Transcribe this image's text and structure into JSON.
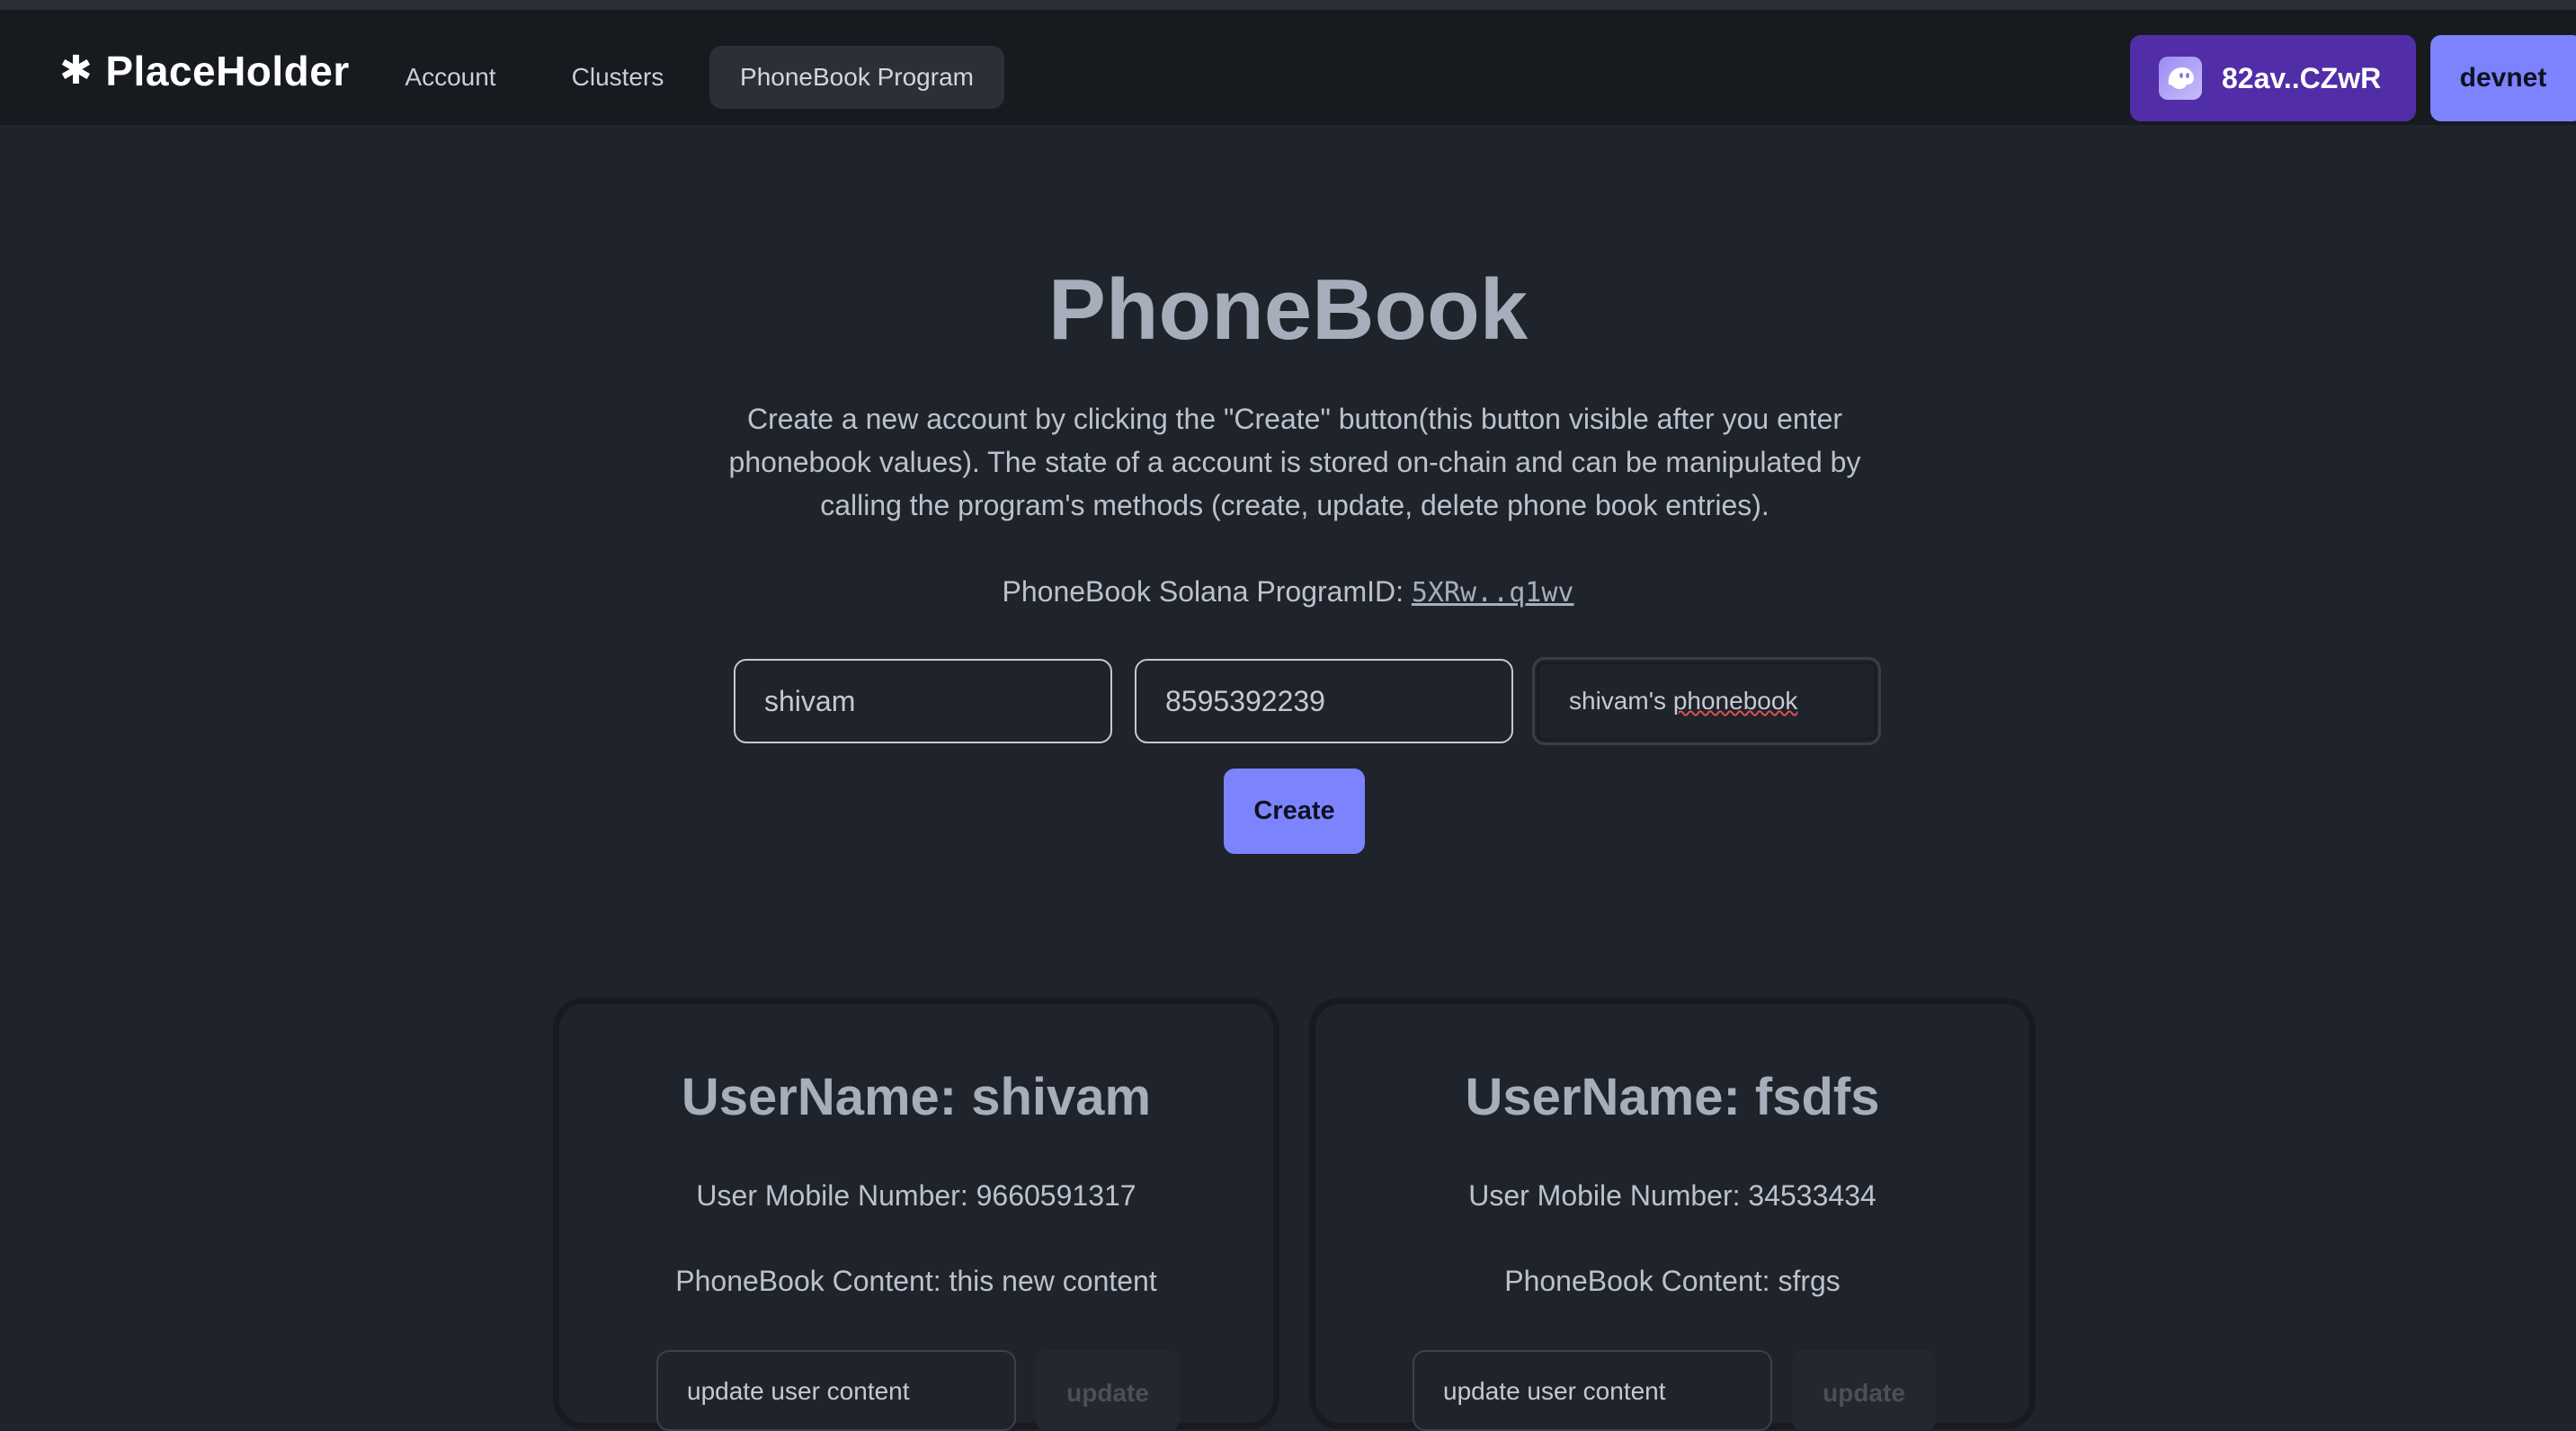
{
  "navbar": {
    "logo_text": "PlaceHolder",
    "links": [
      {
        "label": "Account"
      },
      {
        "label": "Clusters"
      },
      {
        "label": "PhoneBook Program"
      }
    ],
    "wallet_label": "82av..CZwR",
    "cluster_label": "devnet"
  },
  "hero": {
    "title": "PhoneBook",
    "description": "Create a new account by clicking the \"Create\" button(this button visible after you enter phonebook values). The state of a account is stored on-chain and can be manipulated by calling the program's methods (create, update, delete phone book entries).",
    "program_id_label": "PhoneBook Solana ProgramID:",
    "program_id": "5XRw..q1wv"
  },
  "form": {
    "name_value": "shivam",
    "phone_value": "8595392239",
    "content_prefix": "shivam's ",
    "content_misspelled": "phonebook",
    "create_label": "Create"
  },
  "cards": [
    {
      "title": "UserName: shivam",
      "mobile": "User Mobile Number: 9660591317",
      "content": "PhoneBook Content: this new content",
      "update_input_value": "update user content",
      "update_label": "update"
    },
    {
      "title": "UserName: fsdfs",
      "mobile": "User Mobile Number: 34533434",
      "content": "PhoneBook Content: sfrgs",
      "update_input_value": "update user content",
      "update_label": "update"
    }
  ],
  "colors": {
    "background": "#1f232b",
    "navbar": "#171a1f",
    "wallet_button": "#512da8",
    "primary_button": "#7c83fd"
  },
  "icons": {
    "logo": "asterisk-icon",
    "wallet": "phantom-ghost-icon"
  }
}
